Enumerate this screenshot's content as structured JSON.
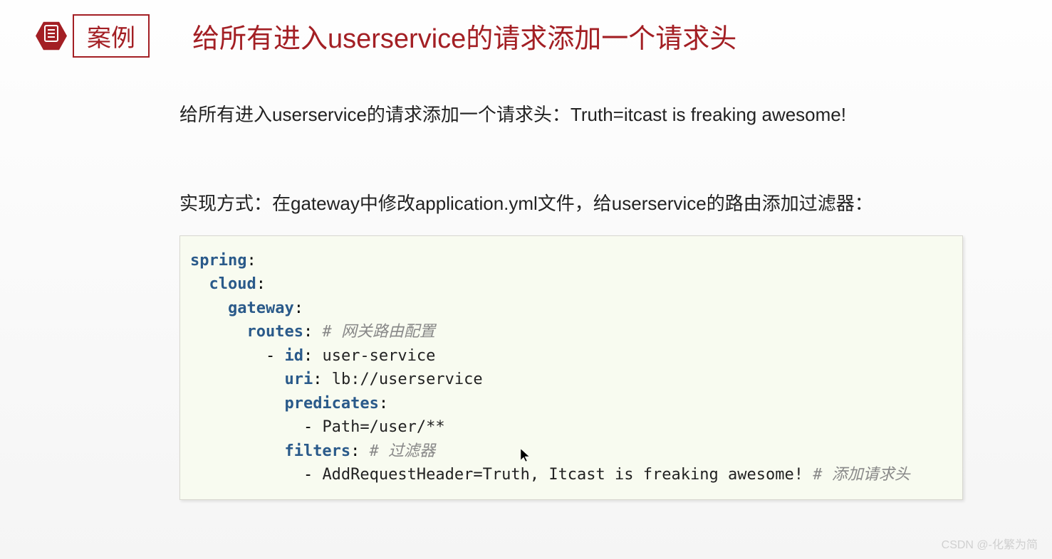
{
  "header": {
    "badge": "案例",
    "title": "给所有进入userservice的请求添加一个请求头"
  },
  "content": {
    "subtitle": "给所有进入userservice的请求添加一个请求头：Truth=itcast is freaking awesome!",
    "implementation": "实现方式：在gateway中修改application.yml文件，给userservice的路由添加过滤器："
  },
  "code": {
    "l1_key": "spring",
    "l2_key": "cloud",
    "l3_key": "gateway",
    "l4_key": "routes",
    "l4_comment": "# 网关路由配置",
    "l5_key": "id",
    "l5_val": "user-service",
    "l6_key": "uri",
    "l6_val": "lb://userservice",
    "l7_key": "predicates",
    "l8_val": "Path=/user/**",
    "l9_key": "filters",
    "l9_comment": "# 过滤器",
    "l10_val": "AddRequestHeader=Truth, Itcast is freaking awesome!",
    "l10_comment": "# 添加请求头"
  },
  "watermark": "CSDN @-化繁为简"
}
